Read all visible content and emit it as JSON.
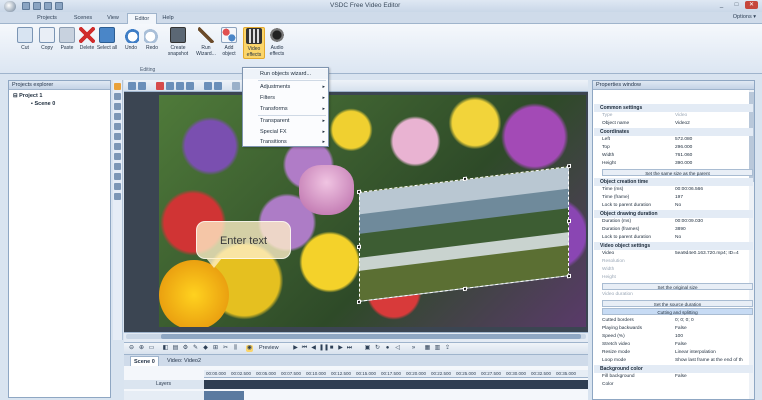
{
  "window": {
    "title": "VSDC Free Video Editor",
    "controls": [
      "_",
      "□",
      "✕"
    ]
  },
  "tabs": [
    "Projects",
    "Scenes",
    "View",
    "Editor",
    "Help"
  ],
  "active_tab": "Editor",
  "options_label": "Options ▾",
  "ribbon": {
    "buttons": [
      "Cut",
      "Copy",
      "Paste",
      "Delete",
      "Select all",
      "Undo",
      "Redo",
      "Create snapshot",
      "Run Wizard...",
      "Add object",
      "Video effects",
      "Audio effects"
    ],
    "group_label": "Editing"
  },
  "video_effects_menu": [
    "Run objects wizard...",
    "Adjustments",
    "Filters",
    "Transforms",
    "Transparent",
    "Special FX",
    "Transitions"
  ],
  "explorer": {
    "title": "Projects explorer",
    "project": "Project 1",
    "scene": "Scene 0"
  },
  "canvas": {
    "speech_text": "Enter text"
  },
  "playback": {
    "preview_label": "Preview"
  },
  "timeline": {
    "tabs": [
      "Scene 0",
      "Video: Video2"
    ],
    "layers_label": "Layers",
    "ruler": [
      "00:00.000",
      "00:02.500",
      "00:05.000",
      "00:07.500",
      "00:10.000",
      "00:12.500",
      "00:15.000",
      "00:17.500",
      "00:20.000",
      "00:22.500",
      "00:25.000",
      "00:27.500",
      "00:30.000",
      "00:32.500",
      "00:35.000"
    ]
  },
  "properties": {
    "title": "Properties window",
    "sections": {
      "common": "Common settings",
      "coordinates": "Coordinates",
      "creation": "Object creation time",
      "drawing": "Object drawing duration",
      "video": "Video object settings",
      "background": "Background color"
    },
    "rows": {
      "type": [
        "Type",
        "Video"
      ],
      "object_name": [
        "Object name",
        "Video2"
      ],
      "left": [
        "Left",
        "572.080"
      ],
      "top": [
        "Top",
        "296.000"
      ],
      "width": [
        "Width",
        "761.060"
      ],
      "height": [
        "Height",
        "390.000"
      ],
      "time_ms": [
        "Time (ms)",
        "00:00:06.566"
      ],
      "time_frame": [
        "Time (frame)",
        "197"
      ],
      "lock_parent_1": [
        "Lock to parent duration",
        "No"
      ],
      "duration_ms": [
        "Duration (ms)",
        "00:00:09.030"
      ],
      "duration_frames": [
        "Duration (frames)",
        "3890"
      ],
      "lock_parent_2": [
        "Lock to parent duration",
        "No"
      ],
      "video": [
        "Video",
        "5ea9d4e0.163.720.mp4; ID=4"
      ],
      "resolution": [
        "Resolution",
        ""
      ],
      "width2": [
        "Width",
        ""
      ],
      "height2": [
        "Height",
        ""
      ],
      "video_duration": [
        "Video duration",
        ""
      ],
      "cutted_borders": [
        "Cutted borders",
        "0; 0; 0; 0"
      ],
      "playing_backwards": [
        "Playing backwards",
        "False"
      ],
      "speed": [
        "Speed (%)",
        "100"
      ],
      "stretch_video": [
        "Stretch video",
        "False"
      ],
      "resize_mode": [
        "Resize mode",
        "Linear interpolation"
      ],
      "loop_mode": [
        "Loop mode",
        "Show last frame at the end of th"
      ],
      "fill_background": [
        "Fill background",
        "False"
      ],
      "color": [
        "Color",
        ""
      ]
    },
    "buttons": {
      "same_size": "Set the same size as the parent",
      "original_size": "Set the original size",
      "source_duration": "Set the source duration",
      "cutting": "Cutting and splitting"
    }
  }
}
